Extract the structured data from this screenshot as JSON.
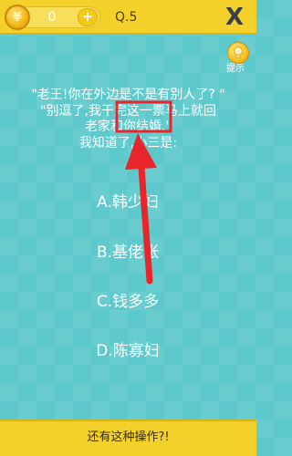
{
  "topbar": {
    "coin_symbol": "¥",
    "coin_count": "0",
    "add_symbol": "+",
    "level": "Q.5",
    "close_symbol": "X"
  },
  "hint": {
    "label": "提示"
  },
  "question": {
    "lines": [
      "\"老王!你在外边是不是有别人了? \"",
      "\"别逗了,我干完这一票马上就回",
      "老家和你结婚.\"",
      "我知道了,小三是:"
    ]
  },
  "options": [
    {
      "label": "A.韩少妇"
    },
    {
      "label": "B.基佬张"
    },
    {
      "label": "C.钱多多"
    },
    {
      "label": "D.陈寡妇"
    }
  ],
  "bottom": {
    "text": "还有这种操作?!"
  },
  "colors": {
    "background": "#5ec9cc",
    "bar": "#f3d12a",
    "annotation": "#e8252b"
  },
  "icons": {
    "coin": "coin-icon",
    "add": "plus-icon",
    "close": "close-icon",
    "hint": "lightbulb-icon"
  }
}
